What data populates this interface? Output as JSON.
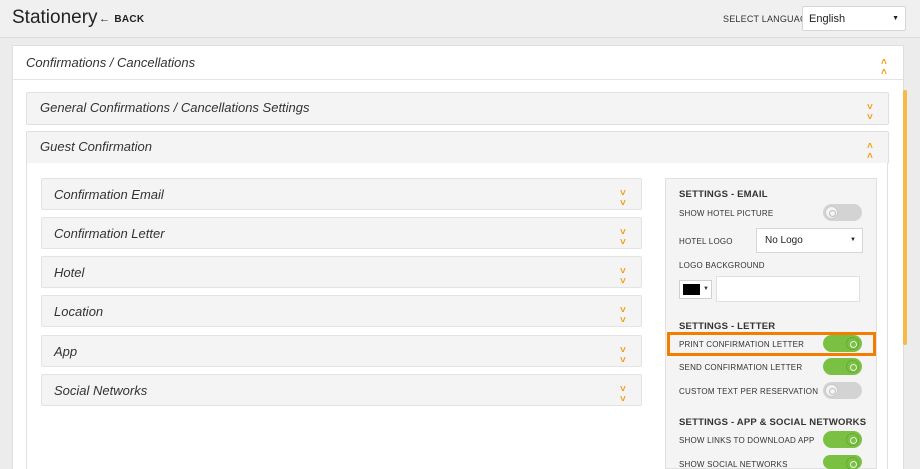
{
  "header": {
    "title": "Stationery",
    "back_label": "BACK",
    "language_label": "SELECT LANGUAGE",
    "language_value": "English"
  },
  "main_section": {
    "title": "Confirmations / Cancellations"
  },
  "accordions": [
    {
      "label": "General Confirmations / Cancellations Settings",
      "expanded": false
    },
    {
      "label": "Guest Confirmation",
      "expanded": true
    }
  ],
  "guest_items": [
    "Confirmation Email",
    "Confirmation Letter",
    "Hotel",
    "Location",
    "App",
    "Social Networks"
  ],
  "settings": {
    "email": {
      "title": "SETTINGS - EMAIL",
      "show_hotel_picture": {
        "label": "SHOW HOTEL PICTURE",
        "on": false
      },
      "hotel_logo": {
        "label": "HOTEL LOGO",
        "value": "No Logo"
      },
      "logo_background": {
        "label": "LOGO BACKGROUND",
        "color": "#000000"
      }
    },
    "letter": {
      "title": "SETTINGS - LETTER",
      "print_confirmation_letter": {
        "label": "PRINT CONFIRMATION LETTER",
        "on": true
      },
      "send_confirmation_letter": {
        "label": "SEND CONFIRMATION LETTER",
        "on": true
      },
      "custom_text_per_reservation": {
        "label": "CUSTOM TEXT PER RESERVATION",
        "on": false
      }
    },
    "app_social": {
      "title": "SETTINGS - APP & SOCIAL NETWORKS",
      "show_links_download_app": {
        "label": "SHOW LINKS TO DOWNLOAD APP",
        "on": true
      },
      "show_social_networks": {
        "label": "SHOW SOCIAL NETWORKS",
        "on": true
      }
    }
  },
  "colors": {
    "accent": "#f39c12",
    "toggle_on": "#7ac143",
    "highlight": "#f27d00"
  }
}
